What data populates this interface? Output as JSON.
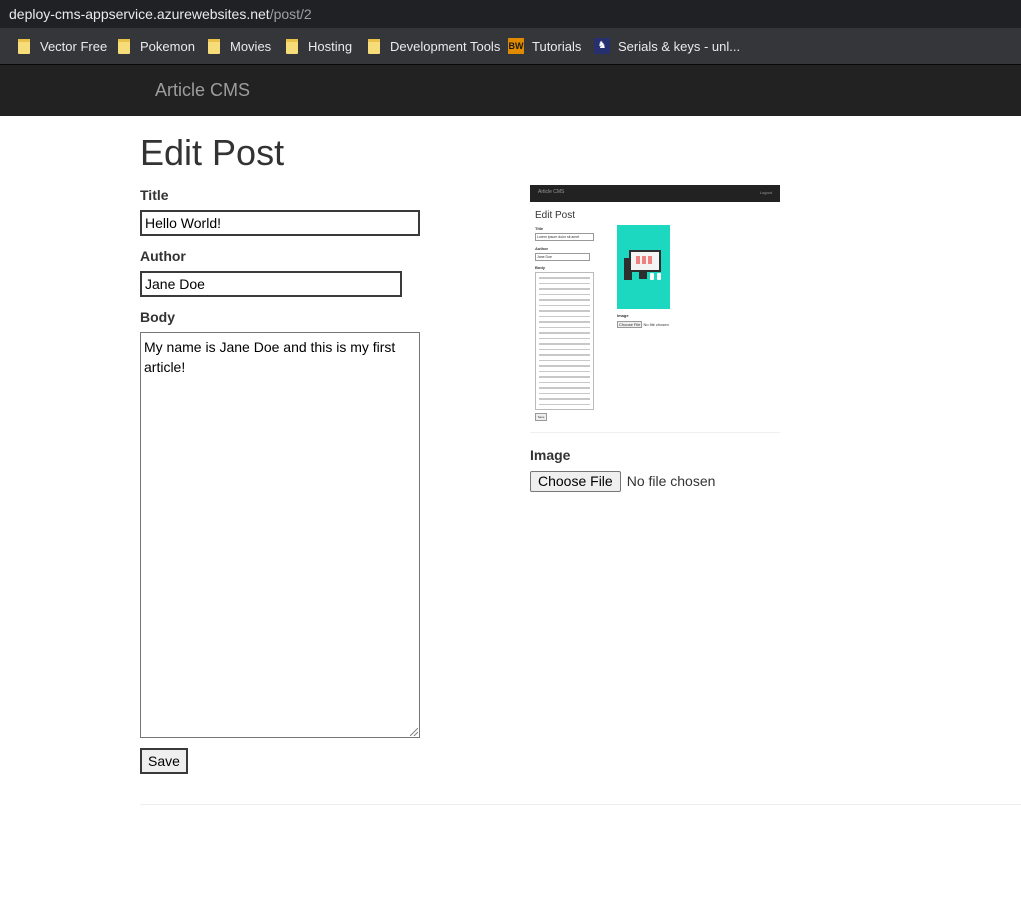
{
  "browser": {
    "url_host": "deploy-cms-appservice.azurewebsites.net",
    "url_path": "/post/2",
    "bookmarks": [
      {
        "label": "Vector Free",
        "icon": "folder-icon"
      },
      {
        "label": "Pokemon",
        "icon": "folder-icon"
      },
      {
        "label": "Movies",
        "icon": "folder-icon"
      },
      {
        "label": "Hosting",
        "icon": "folder-icon"
      },
      {
        "label": "Development Tools",
        "icon": "folder-icon"
      },
      {
        "label": "Tutorials",
        "icon": "bw-icon",
        "icon_text": "BW"
      },
      {
        "label": "Serials & keys - unl...",
        "icon": "keygen-icon"
      }
    ]
  },
  "navbar": {
    "brand": "Article CMS"
  },
  "form": {
    "heading": "Edit Post",
    "title_label": "Title",
    "title_value": "Hello World!",
    "author_label": "Author",
    "author_value": "Jane Doe",
    "body_label": "Body",
    "body_value": "My name is Jane Doe and this is my first article!",
    "save_label": "Save",
    "image_label": "Image",
    "choose_file_label": "Choose File",
    "file_status": "No file chosen"
  },
  "thumbnail": {
    "brand": "Article CMS",
    "login": "Logout",
    "heading": "Edit Post",
    "title_label": "Title",
    "title_value": "Lorem ipsum dolor sit amet",
    "author_label": "Author",
    "author_value": "Jane Doe",
    "body_label": "Body",
    "save_label": "Save",
    "image_label": "Image",
    "choose_file_label": "Choose File",
    "file_status": "No file chosen"
  },
  "colors": {
    "navbar_bg": "#222222",
    "brand_text": "#9d9d9d",
    "thumbnail_image_bg": "#1dd8c0"
  }
}
